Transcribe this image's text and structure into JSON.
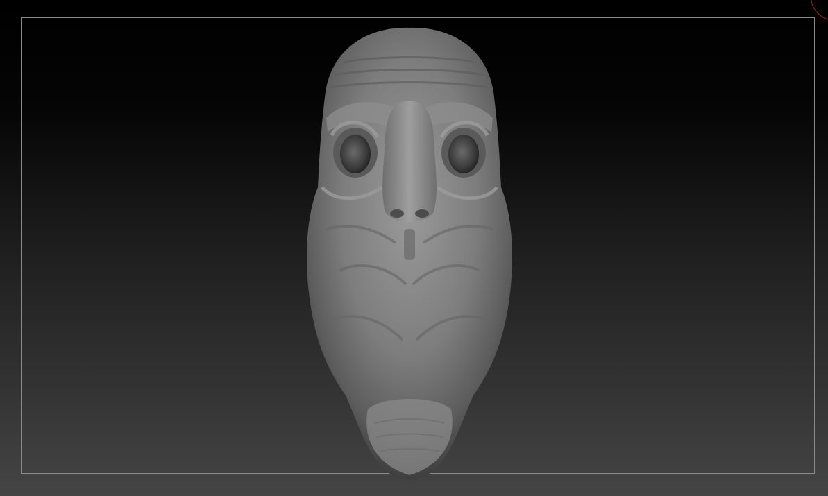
{
  "canvas": {
    "model_type": "sculpted-head-mesh",
    "frame_color": "#8a8a8a",
    "accent_ring_color": "#c0141a",
    "background_top": "#000000",
    "background_bottom": "#454545",
    "material_color": "#8c8c8c"
  }
}
